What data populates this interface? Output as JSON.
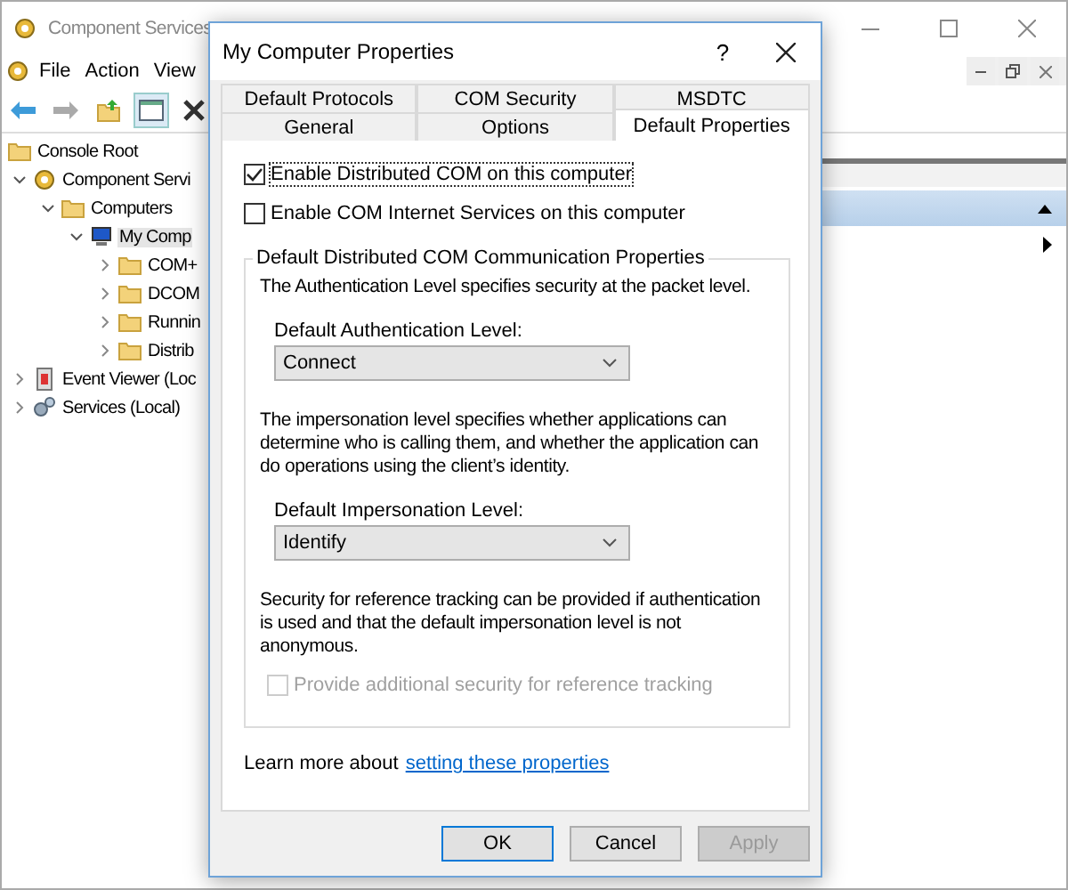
{
  "app_window": {
    "title": "Component Services",
    "menu": [
      "File",
      "Action",
      "View"
    ],
    "tree": [
      {
        "label": "Console Root",
        "kind": "folder",
        "selected": false,
        "children": [
          {
            "label": "Component Servi",
            "kind": "gear",
            "selected": false,
            "expanded": true,
            "children": [
              {
                "label": "Computers",
                "kind": "folder",
                "selected": false,
                "expanded": true,
                "children": [
                  {
                    "label": "My Comp",
                    "kind": "computer",
                    "selected": true,
                    "expanded": true,
                    "children": [
                      {
                        "label": "COM+",
                        "kind": "folder",
                        "selected": false,
                        "expanded": false
                      },
                      {
                        "label": "DCOM",
                        "kind": "folder",
                        "selected": false,
                        "expanded": false
                      },
                      {
                        "label": "Runnin",
                        "kind": "folder",
                        "selected": false,
                        "expanded": false
                      },
                      {
                        "label": "Distrib",
                        "kind": "folder",
                        "selected": false,
                        "expanded": false
                      }
                    ]
                  }
                ]
              }
            ]
          },
          {
            "label": "Event Viewer (Loc",
            "kind": "log",
            "selected": false,
            "expanded": false
          },
          {
            "label": "Services (Local)",
            "kind": "services",
            "selected": false,
            "expanded": false
          }
        ]
      }
    ]
  },
  "dialog": {
    "title": "My Computer Properties",
    "help": "?",
    "tab_rows": [
      [
        {
          "label": "Default Protocols",
          "selected": false
        },
        {
          "label": "COM Security",
          "selected": false
        },
        {
          "label": "MSDTC",
          "selected": false
        }
      ],
      [
        {
          "label": "General",
          "selected": false
        },
        {
          "label": "Options",
          "selected": false
        },
        {
          "label": "Default Properties",
          "selected": true
        }
      ]
    ],
    "checkboxes": [
      {
        "label": "Enable Distributed COM on this computer",
        "checked": true,
        "focused": true
      },
      {
        "label": "Enable COM Internet Services on this computer",
        "checked": false,
        "focused": false
      }
    ],
    "group": {
      "legend": "Default Distributed COM Communication Properties",
      "auth_text": "The Authentication Level specifies security at the packet level.",
      "auth_label": "Default Authentication Level:",
      "auth_value": "Connect",
      "imp_text": "The impersonation level specifies whether applications can determine who is calling them, and whether the application can do operations using the client’s identity.",
      "imp_label": "Default Impersonation Level:",
      "imp_value": "Identify",
      "ref_text": "Security for reference tracking can be provided if authentication is used and that the default impersonation level is not anonymous.",
      "ref_checkbox": {
        "label": "Provide additional security for reference tracking",
        "checked": false,
        "disabled": true
      }
    },
    "learn_text": "Learn more about",
    "learn_link": "setting these properties",
    "buttons": [
      {
        "label": "OK",
        "default": true,
        "disabled": false
      },
      {
        "label": "Cancel",
        "default": false,
        "disabled": false
      },
      {
        "label": "Apply",
        "default": false,
        "disabled": true
      }
    ]
  }
}
